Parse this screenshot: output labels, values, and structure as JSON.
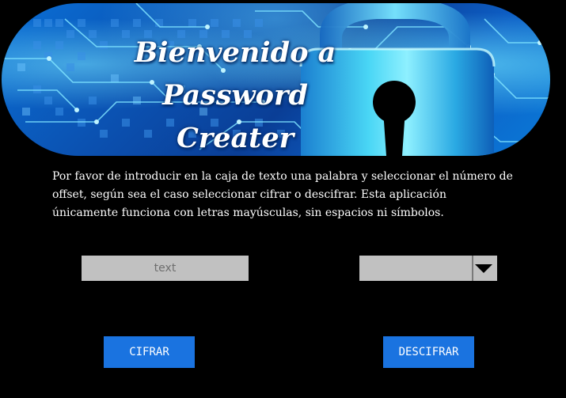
{
  "hero": {
    "title_line1": "Bienvenido a Password",
    "title_line2": "Creater"
  },
  "instructions": {
    "text": "Por favor de introducir en la caja de texto una palabra y seleccionar el  número de offset, según sea el caso seleccionar cifrar o descifrar. Esta aplicación únicamente funciona con letras mayúsculas, sin espacios ni símbolos."
  },
  "word_input": {
    "value": "",
    "placeholder": "text"
  },
  "offset_select": {
    "selected": ""
  },
  "buttons": {
    "encrypt_label": "CIFRAR",
    "decrypt_label": "DESCIFRAR"
  },
  "colors": {
    "background": "#000000",
    "button": "#1a73e0",
    "field": "#c1c1c1",
    "banner": "#0b4fae"
  },
  "icons": {
    "hero": "padlock-icon",
    "select": "chevron-down-icon"
  }
}
